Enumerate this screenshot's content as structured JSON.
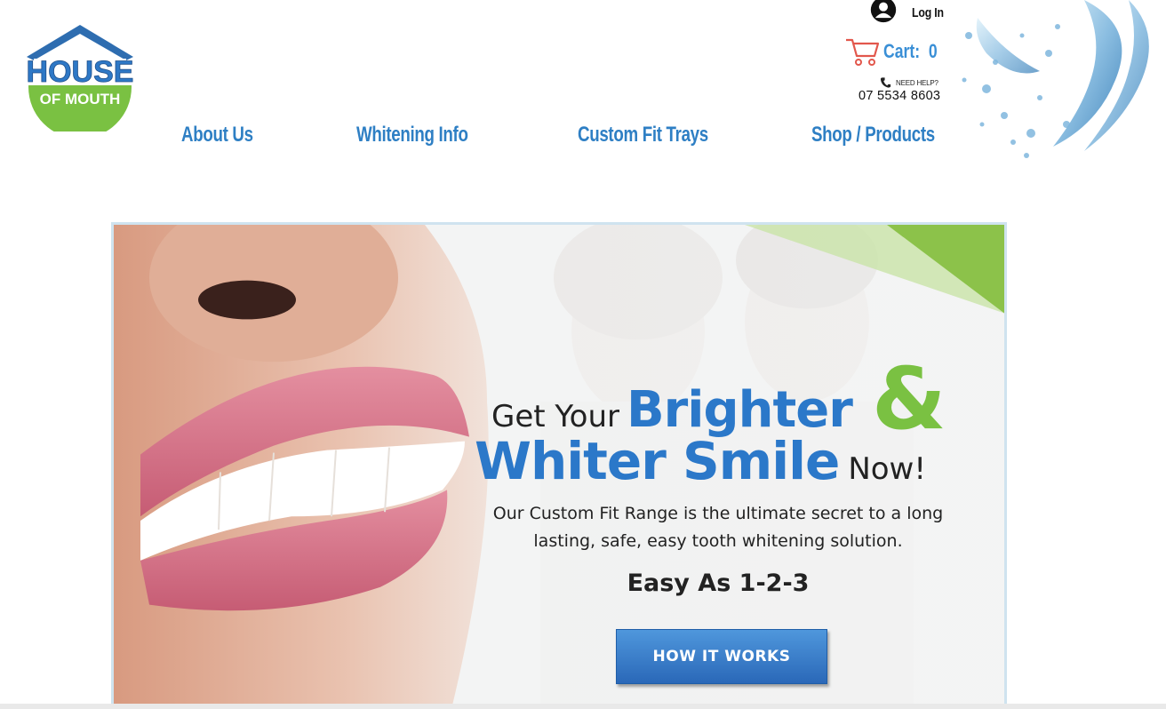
{
  "brand": {
    "logo_line1": "HOUSE",
    "logo_line2": "OF MOUTH",
    "blue": "#2b78c9",
    "green": "#7ac142"
  },
  "header": {
    "login_label": "Log In",
    "cart_label": "Cart:",
    "cart_count": "0",
    "help_label": "NEED HELP?",
    "phone": "07 5534 8603",
    "icons": [
      "avatar-icon",
      "cart-icon",
      "phone-icon",
      "water-splash"
    ]
  },
  "nav": {
    "items": [
      {
        "label": "About Us"
      },
      {
        "label": "Whitening Info"
      },
      {
        "label": "Custom Fit Trays"
      },
      {
        "label": "Shop / Products"
      }
    ]
  },
  "hero": {
    "line1_get": "Get Your",
    "line1_brighter": "Brighter",
    "ampersand": "&",
    "line2_whiter": "Whiter Smile",
    "line2_now": "Now!",
    "subtitle_1": "Our Custom Fit Range is the ultimate secret to a long",
    "subtitle_2": "lasting, safe, easy tooth whitening solution.",
    "easy": "Easy As 1-2-3",
    "cta_label": "HOW IT WORKS"
  }
}
